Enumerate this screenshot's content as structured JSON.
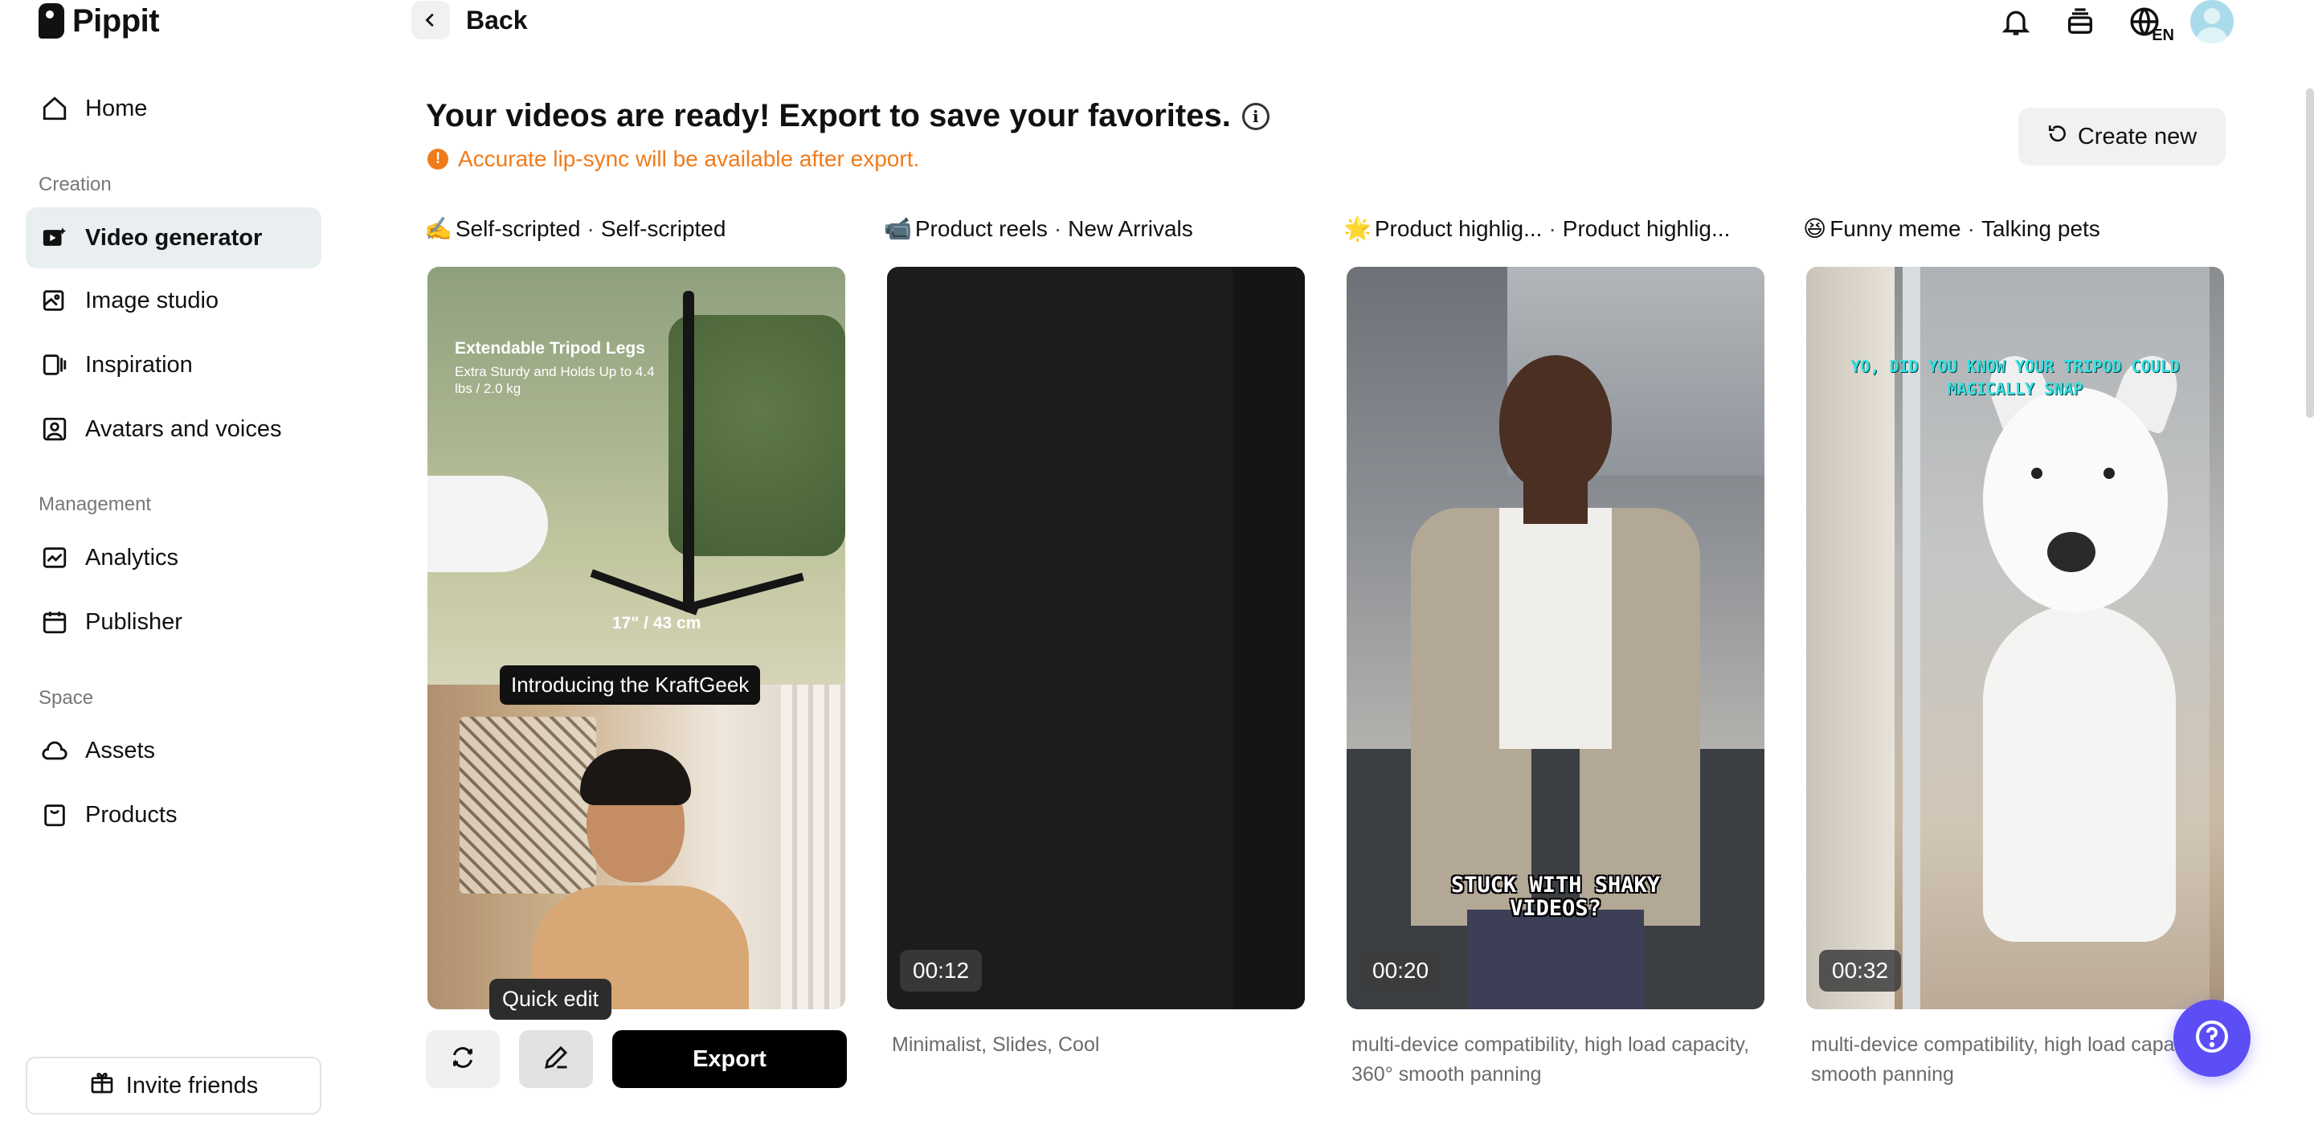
{
  "app": {
    "name": "Pippit"
  },
  "sidebar": {
    "home": "Home",
    "sections": {
      "creation": "Creation",
      "management": "Management",
      "space": "Space"
    },
    "items": {
      "video_generator": "Video generator",
      "image_studio": "Image studio",
      "inspiration": "Inspiration",
      "avatars_voices": "Avatars and voices",
      "analytics": "Analytics",
      "publisher": "Publisher",
      "assets": "Assets",
      "products": "Products"
    },
    "invite": "Invite friends"
  },
  "topbar": {
    "back": "Back",
    "lang": "EN"
  },
  "main": {
    "heading": "Your videos are ready! Export to save your favorites.",
    "warning": "Accurate lip-sync will be available after export.",
    "create_new": "Create new"
  },
  "cards": [
    {
      "emoji": "✍️",
      "type": "Self-scripted",
      "subtype": "Self-scripted",
      "overlay_title": "Extendable Tripod Legs",
      "overlay_sub": "Extra Sturdy and Holds Up to 4.4 lbs / 2.0 kg",
      "measure": "17\" / 43 cm",
      "caption": "Introducing the KraftGeek"
    },
    {
      "emoji": "📹",
      "type": "Product reels",
      "subtype": "New Arrivals",
      "duration": "00:12",
      "tags": "Minimalist, Slides, Cool"
    },
    {
      "emoji": "🌟",
      "type": "Product highlig...",
      "subtype": "Product highlig...",
      "duration": "00:20",
      "caption": "STUCK WITH SHAKY VIDEOS?",
      "tags": "multi-device compatibility, high load capacity, 360° smooth panning"
    },
    {
      "emoji": "😆",
      "type": "Funny meme",
      "subtype": "Talking pets",
      "duration": "00:32",
      "caption": "YO, DID YOU KNOW YOUR TRIPOD COULD MAGICALLY SNAP",
      "tags": "multi-device compatibility, high load capa 360° smooth panning"
    }
  ],
  "actions": {
    "tooltip": "Quick edit",
    "export": "Export"
  },
  "colors": {
    "accent_warning": "#f07b1a",
    "active_nav_bg": "#e9eef1",
    "help_fab": "#5b4ef5"
  }
}
